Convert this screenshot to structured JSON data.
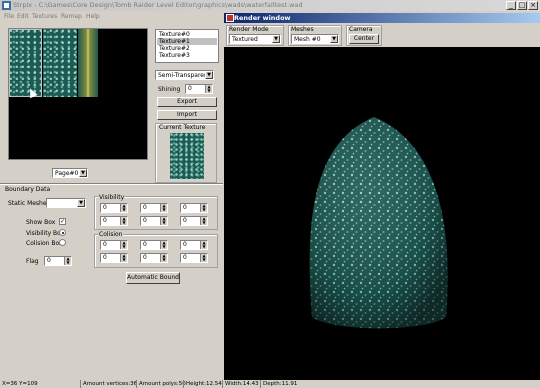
{
  "window": {
    "title": "Strpix - C:\\Games\\Core Design\\Tomb Raider Level Editor\\graphics\\wads\\waterfalltest.wad",
    "controls": [
      "_",
      "□",
      "×"
    ]
  },
  "menu": {
    "items": [
      "File",
      "Edit",
      "Textures",
      "Remap",
      "Help"
    ]
  },
  "textures": {
    "list": [
      "Texture#0",
      "Texture#1",
      "Texture#2",
      "Texture#3"
    ],
    "selected_index": 1,
    "blend_mode": "Semi-Transparent",
    "shining_label": "Shining",
    "shining_value": "0",
    "export_label": "Export",
    "import_label": "Import",
    "current_texture_label": "Current Texture",
    "page_select": "Page#0"
  },
  "boundary": {
    "group_label": "Boundary Data",
    "static_meshes_label": "Static Meshes",
    "show_box_label": "Show Box",
    "visibility_box_label": "Visibility Box",
    "collision_box_label": "Colision Box",
    "flag_label": "Flag",
    "flag_value": "0",
    "visibility_label": "Visibility",
    "visibility_values": [
      "0",
      "0",
      "0",
      "0",
      "0",
      "0"
    ],
    "collision_label": "Colision",
    "collision_values": [
      "0",
      "0",
      "0",
      "0",
      "0",
      "0"
    ],
    "auto_bound_label": "Automatic Bound"
  },
  "render": {
    "title": "Render window",
    "render_mode_label": "Render Mode",
    "render_mode_value": "Textured",
    "meshes_label": "Meshes",
    "meshes_value": "Mesh #0",
    "camera_label": "Camera",
    "center_label": "Center"
  },
  "status": {
    "coords": "X=36 Y=109",
    "vertices": "Amount vertices:36",
    "polys": "Amount polys:50",
    "height": "Height:12.54",
    "width": "Width:14.43",
    "depth": "Depth:11.91"
  },
  "colors": {
    "render_title_start": "#0a246a",
    "texture_base": "#1d5a54",
    "texture_spots": "#a8e6d6"
  }
}
